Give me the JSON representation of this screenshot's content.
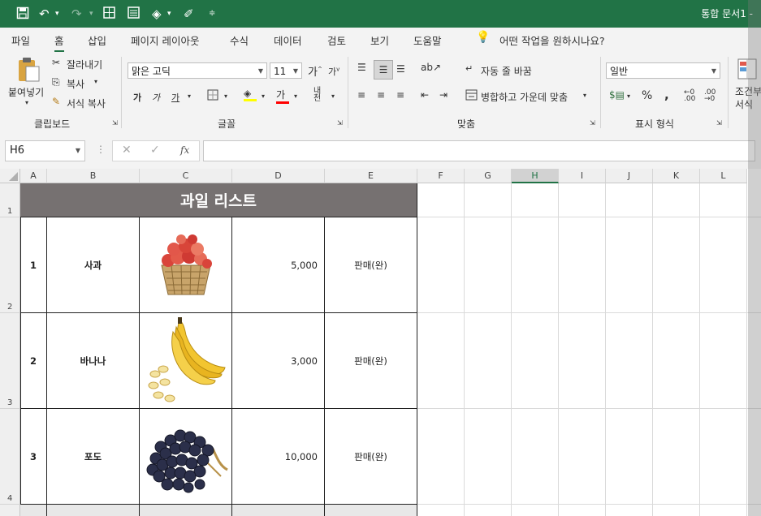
{
  "titlebar": {
    "doc_title": "통합 문서1  -"
  },
  "menu": {
    "items": [
      "파일",
      "홈",
      "삽입",
      "페이지 레이아웃",
      "수식",
      "데이터",
      "검토",
      "보기",
      "도움말"
    ],
    "search_placeholder": "어떤 작업을 원하시나요?"
  },
  "clipboard": {
    "paste": "붙여넣기",
    "cut": "잘라내기",
    "copy": "복사",
    "format_painter": "서식 복사",
    "group": "클립보드"
  },
  "font": {
    "name": "맑은 고딕",
    "size": "11",
    "bold": "가",
    "italic": "가",
    "underline": "가",
    "group": "글꼴"
  },
  "alignment": {
    "wrap_text": "자동 줄 바꿈",
    "merge_center": "병합하고 가운데 맞춤",
    "group": "맞춤"
  },
  "number": {
    "format": "일반",
    "percent": "%",
    "comma": ",",
    "group": "표시 형식"
  },
  "styles": {
    "cond_format_line1": "조건부",
    "cond_format_line2": "서식"
  },
  "formula_bar": {
    "name_box": "H6",
    "fx": "fx",
    "value": ""
  },
  "columns": [
    "A",
    "B",
    "C",
    "D",
    "E",
    "F",
    "G",
    "H",
    "I",
    "J",
    "K",
    "L"
  ],
  "selected_column": "H",
  "row_numbers": [
    "1",
    "2",
    "3",
    "4"
  ],
  "table": {
    "title": "과일 리스트",
    "rows": [
      {
        "no": "1",
        "name": "사과",
        "image": "apple-basket-image",
        "price": "5,000",
        "status": "판매(완)"
      },
      {
        "no": "2",
        "name": "바나나",
        "image": "banana-image",
        "price": "3,000",
        "status": "판매(완)"
      },
      {
        "no": "3",
        "name": "포도",
        "image": "grape-image",
        "price": "10,000",
        "status": "판매(완)"
      }
    ]
  },
  "colors": {
    "excel_green": "#217346",
    "title_fill": "#767171"
  }
}
